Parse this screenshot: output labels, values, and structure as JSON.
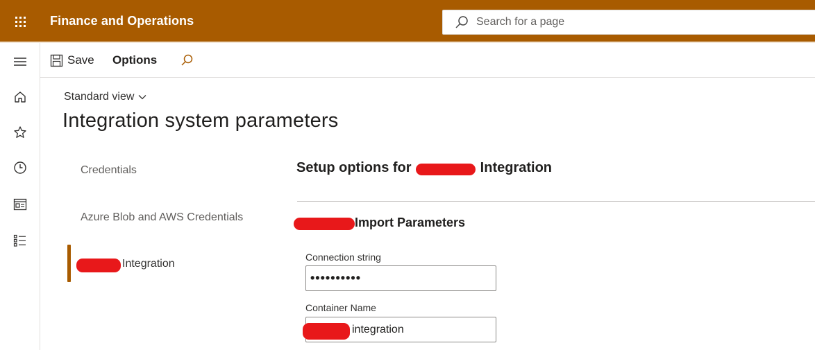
{
  "app": {
    "title": "Finance and Operations",
    "accent_color": "#a85b00",
    "waffle_icon": "waffle-icon"
  },
  "search": {
    "placeholder": "Search for a page",
    "icon": "search-icon"
  },
  "nav_rail": [
    {
      "name": "hamburger-menu",
      "icon": "hamburger-icon"
    },
    {
      "name": "home",
      "icon": "home-icon"
    },
    {
      "name": "favorites",
      "icon": "star-icon"
    },
    {
      "name": "recent",
      "icon": "clock-icon"
    },
    {
      "name": "workspaces",
      "icon": "workspace-icon"
    },
    {
      "name": "modules",
      "icon": "list-icon"
    }
  ],
  "action_pane": {
    "save_label": "Save",
    "options_label": "Options",
    "find_icon": "search-icon"
  },
  "view": {
    "label": "Standard view",
    "icon": "chevron-down-icon"
  },
  "page": {
    "title": "Integration system parameters"
  },
  "tabs": [
    {
      "label": "Credentials"
    },
    {
      "label": "Azure Blob and AWS Credentials"
    },
    {
      "label": "Integration",
      "selected": true,
      "redacted_prefix": true
    }
  ],
  "section": {
    "title_prefix": "Setup options for",
    "title_suffix": "Integration",
    "redacted_middle": true
  },
  "group": {
    "title": "Import Parameters",
    "redacted_prefix": true
  },
  "fields": {
    "connection_string": {
      "label": "Connection string",
      "value": "••••••••••"
    },
    "container_name": {
      "label": "Container Name",
      "value": "integration",
      "redacted_prefix": true
    }
  },
  "redaction_color": "#e8181a"
}
